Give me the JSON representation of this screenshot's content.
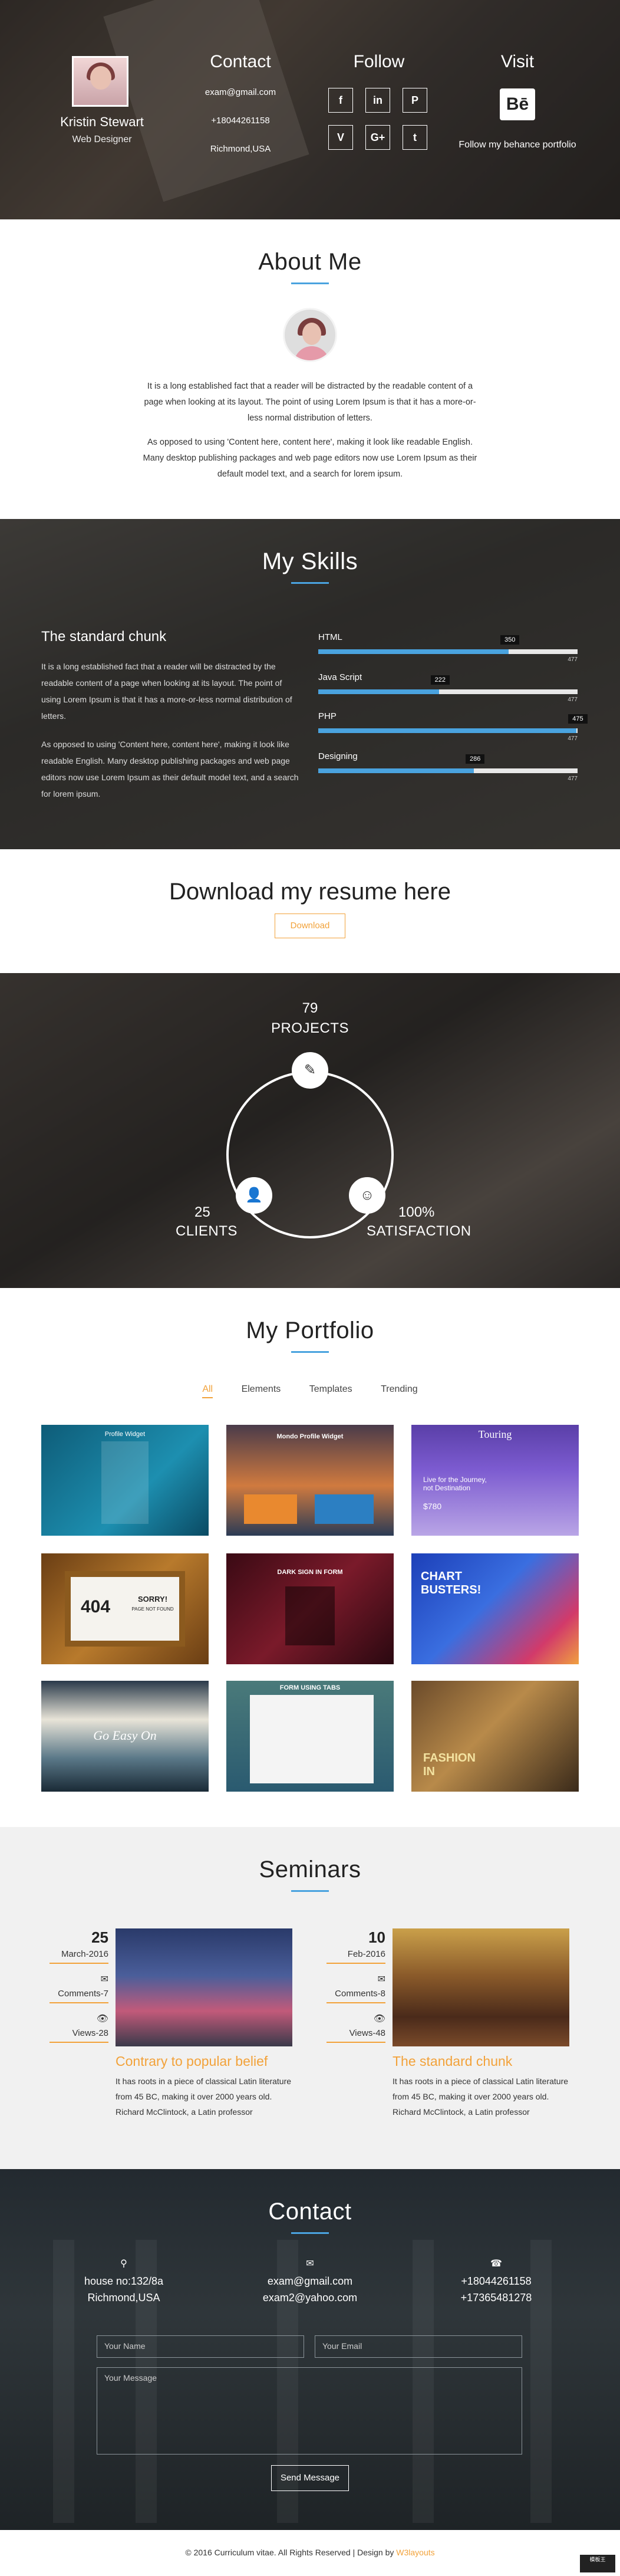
{
  "header": {
    "name": "Kristin Stewart",
    "role": "Web Designer",
    "contact_title": "Contact",
    "email": "exam@gmail.com",
    "phone": "+18044261158",
    "city": "Richmond,USA",
    "follow_title": "Follow",
    "social": [
      "f",
      "in",
      "P",
      "V",
      "G+",
      "t"
    ],
    "social_icons": [
      "facebook-icon",
      "linkedin-icon",
      "pinterest-icon",
      "vimeo-icon",
      "google-plus-icon",
      "tumblr-icon"
    ],
    "visit_title": "Visit",
    "behance_glyph": "Bē",
    "behance_text": "Follow my behance portfolio"
  },
  "about": {
    "title": "About Me",
    "p1": "It is a long established fact that a reader will be distracted by the readable content of a page when looking at its layout. The point of using Lorem Ipsum is that it has a more-or-less normal distribution of letters.",
    "p2": "As opposed to using 'Content here, content here', making it look like readable English. Many desktop publishing packages and web page editors now use Lorem Ipsum as their default model text, and a search for lorem ipsum."
  },
  "skills": {
    "title": "My Skills",
    "heading": "The standard chunk",
    "p1": "It is a long established fact that a reader will be distracted by the readable content of a page when looking at its layout. The point of using Lorem Ipsum is that it has a more-or-less normal distribution of letters.",
    "p2": "As opposed to using 'Content here, content here', making it look like readable English. Many desktop publishing packages and web page editors now use Lorem Ipsum as their default model text, and a search for lorem ipsum.",
    "max": "477",
    "bars": [
      {
        "label": "HTML",
        "value": "350",
        "fraction": 0.734
      },
      {
        "label": "Java Script",
        "value": "222",
        "fraction": 0.465
      },
      {
        "label": "PHP",
        "value": "475",
        "fraction": 0.996
      },
      {
        "label": "Designing",
        "value": "286",
        "fraction": 0.6
      }
    ]
  },
  "download": {
    "title": "Download my resume here",
    "button": "Download"
  },
  "stats": {
    "projects_num": "79",
    "projects_label": "PROJECTS",
    "clients_num": "25",
    "clients_label": "CLIENTS",
    "satisfaction_num": "100%",
    "satisfaction_label": "SATISFACTION"
  },
  "portfolio": {
    "title": "My Portfolio",
    "tabs": [
      "All",
      "Elements",
      "Templates",
      "Trending"
    ],
    "tiles": [
      {
        "caption": "Profile Widget"
      },
      {
        "caption": "Mondo Profile Widget"
      },
      {
        "caption": "Touring"
      },
      {
        "caption": "404"
      },
      {
        "caption": "DARK SIGN IN FORM"
      },
      {
        "caption": "CHART BUSTERS!"
      },
      {
        "caption": "Go Easy On"
      },
      {
        "caption": "FORM USING TABS"
      },
      {
        "caption": "FASHION IN"
      }
    ],
    "tile_texts": {
      "touring_sub": "Live for the Journey, not Destination",
      "touring_price": "$780",
      "sorry": "SORRY!",
      "not_found": "PAGE NOT FOUND"
    }
  },
  "seminars": {
    "title": "Seminars",
    "items": [
      {
        "day": "25",
        "month": "March-2016",
        "comments": "Comments-7",
        "views": "Views-28",
        "heading": "Contrary to popular belief",
        "text": "It has roots in a piece of classical Latin literature from 45 BC, making it over 2000 years old. Richard McClintock, a Latin professor"
      },
      {
        "day": "10",
        "month": "Feb-2016",
        "comments": "Comments-8",
        "views": "Views-48",
        "heading": "The standard chunk",
        "text": "It has roots in a piece of classical Latin literature from 45 BC, making it over 2000 years old. Richard McClintock, a Latin professor"
      }
    ]
  },
  "contact": {
    "title": "Contact",
    "address1": "house no:132/8a",
    "address2": "Richmond,USA",
    "email1": "exam@gmail.com",
    "email2": "exam2@yahoo.com",
    "phone1": "+18044261158",
    "phone2": "+17365481278",
    "name_placeholder": "Your Name",
    "email_placeholder": "Your Email",
    "message_placeholder": "Your Message",
    "send": "Send Message"
  },
  "footer": {
    "text": "© 2016 Curriculum vitae. All Rights Reserved | Design by",
    "link": "W3layouts",
    "badge": "模板王"
  }
}
